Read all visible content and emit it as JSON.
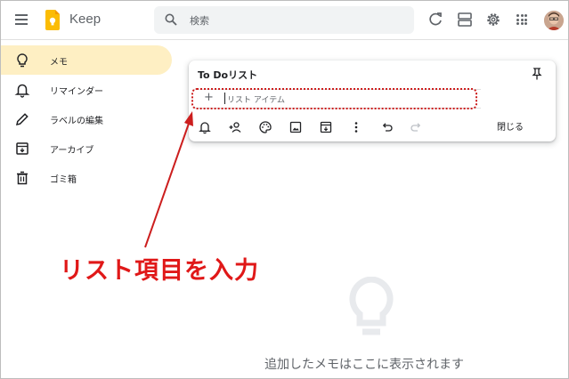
{
  "header": {
    "app_title": "Keep",
    "search_placeholder": "検索",
    "icons": [
      "menu-icon",
      "keep-logo",
      "search-icon",
      "refresh-icon",
      "list-view-icon",
      "gear-icon",
      "apps-grid-icon",
      "avatar"
    ]
  },
  "sidebar": {
    "items": [
      {
        "label": "メモ",
        "icon": "lightbulb-icon",
        "active": true
      },
      {
        "label": "リマインダー",
        "icon": "bell-icon",
        "active": false
      },
      {
        "label": "ラベルの編集",
        "icon": "pencil-icon",
        "active": false
      },
      {
        "label": "アーカイブ",
        "icon": "archive-icon",
        "active": false
      },
      {
        "label": "ゴミ箱",
        "icon": "trash-icon",
        "active": false
      }
    ]
  },
  "note": {
    "title": "To Doリスト",
    "list_placeholder": "リスト アイテム",
    "plus": "+",
    "close_label": "閉じる",
    "toolbar_icons": [
      "bell-plus-icon",
      "person-add-icon",
      "palette-icon",
      "image-icon",
      "archive-icon",
      "more-vert-icon",
      "undo-icon",
      "redo-icon"
    ]
  },
  "annotation": {
    "text": "リスト項目を入力",
    "color": "#e01818"
  },
  "empty_state": {
    "message": "追加したメモはここに表示されます"
  },
  "colors": {
    "active_sidebar": "#feefc3",
    "accent": "#fbbc04"
  }
}
